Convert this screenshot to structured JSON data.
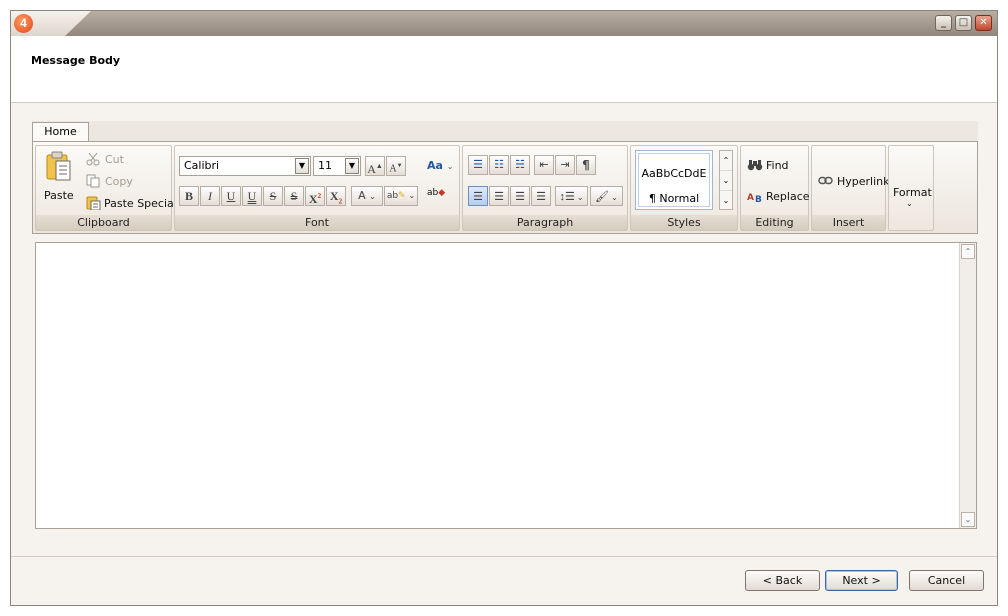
{
  "window": {
    "app_badge": "4",
    "minimize_glyph": "_",
    "maximize_glyph": "□",
    "close_glyph": "✕"
  },
  "header": {
    "title": "Message Body"
  },
  "ribbon": {
    "tabs": [
      {
        "label": "Home"
      }
    ],
    "clipboard": {
      "label": "Clipboard",
      "paste": "Paste",
      "cut": "Cut",
      "copy": "Copy",
      "paste_special": "Paste Special"
    },
    "font": {
      "label": "Font",
      "font_name": "Calibri",
      "font_size": "11",
      "grow_label": "A",
      "shrink_label": "A",
      "change_case_label": "Aa",
      "bold": "B",
      "italic": "I",
      "underline": "U",
      "double_underline": "U",
      "strike": "S",
      "double_strike": "S",
      "superscript": "X",
      "subscript": "X",
      "font_color": "A",
      "highlight": "ab",
      "clear_format": "ab",
      "launcher": "↘"
    },
    "paragraph": {
      "label": "Paragraph",
      "show_marks": "¶",
      "launcher": "↘"
    },
    "styles": {
      "label": "Styles",
      "preview_text": "AaBbCcDdE",
      "style_name": "¶ Normal",
      "launcher": "↘"
    },
    "editing": {
      "label": "Editing",
      "find": "Find",
      "replace": "Replace"
    },
    "insert": {
      "label": "Insert",
      "hyperlink": "Hyperlink",
      "launcher": "↘"
    },
    "format": {
      "label": "Format"
    }
  },
  "footer": {
    "back": "< Back",
    "next": "Next >",
    "cancel": "Cancel"
  },
  "colors": {
    "accent": "#e2481a",
    "titlebar": "#93877c",
    "panel": "#f6f3ee",
    "focus": "#40669a"
  }
}
